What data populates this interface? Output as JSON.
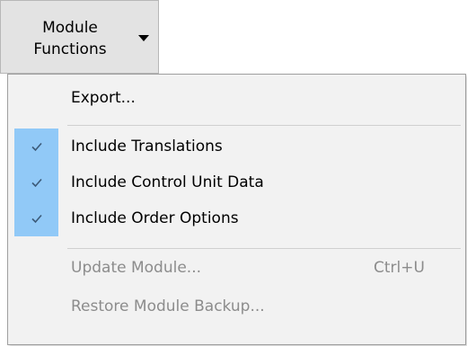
{
  "toolbar": {
    "module_button": {
      "line1": "Module",
      "line2": "Functions"
    }
  },
  "menu": {
    "items": [
      {
        "label": "Export...",
        "checked": false,
        "enabled": true,
        "shortcut": ""
      },
      {
        "label": "Include Translations",
        "checked": true,
        "enabled": true,
        "shortcut": ""
      },
      {
        "label": "Include Control Unit Data",
        "checked": true,
        "enabled": true,
        "shortcut": ""
      },
      {
        "label": "Include Order Options",
        "checked": true,
        "enabled": true,
        "shortcut": ""
      },
      {
        "label": "Update Module...",
        "checked": false,
        "enabled": false,
        "shortcut": "Ctrl+U"
      },
      {
        "label": "Restore Module Backup...",
        "checked": false,
        "enabled": false,
        "shortcut": ""
      }
    ]
  },
  "colors": {
    "button_bg": "#e3e3e3",
    "menu_bg": "#f2f2f2",
    "check_highlight": "#91c9f7",
    "check_mark": "#3c5a78",
    "disabled_text": "#8c8c8c"
  },
  "icons": {
    "button_caret": "caret-down-icon",
    "checked": "checkmark-icon"
  }
}
